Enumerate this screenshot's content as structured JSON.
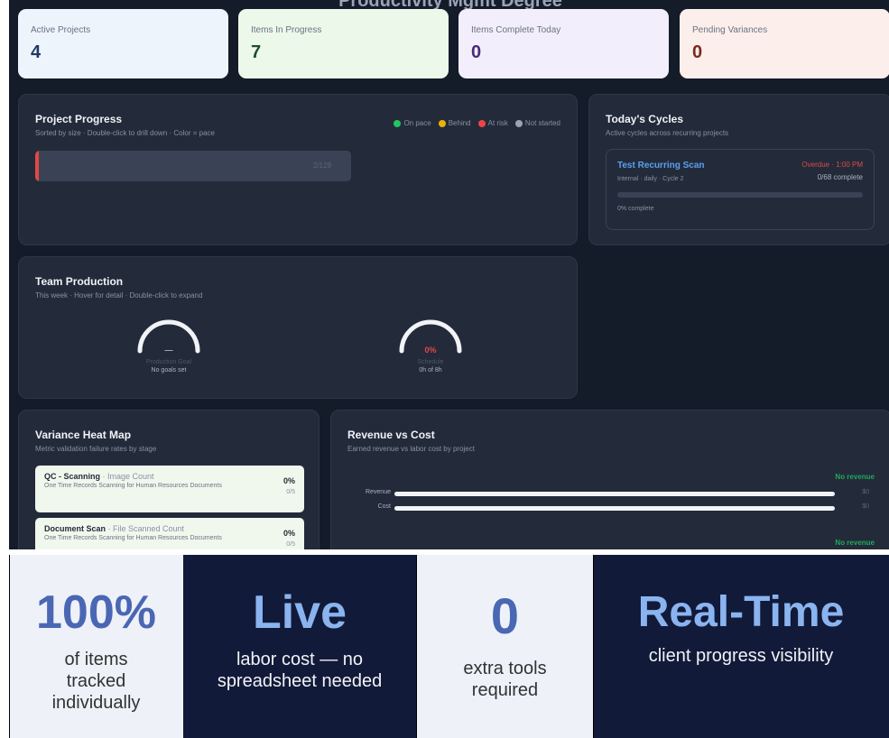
{
  "page_title": "Productivity Mgmt Degree",
  "stats": [
    {
      "label": "Active Projects",
      "value": "4",
      "bg": "#eef4fc",
      "color": "#1f3a68"
    },
    {
      "label": "Items In Progress",
      "value": "7",
      "bg": "#ecf8ea",
      "color": "#1f4f2a"
    },
    {
      "label": "Items Complete Today",
      "value": "0",
      "bg": "#f3eefb",
      "color": "#4a2a7a"
    },
    {
      "label": "Pending Variances",
      "value": "0",
      "bg": "#fcefeb",
      "color": "#7a2a1f"
    }
  ],
  "project_progress": {
    "title": "Project Progress",
    "subtitle": "Sorted by size · Double-click to drill down · Color = pace",
    "legend": [
      {
        "label": "On pace",
        "color": "#22c55e"
      },
      {
        "label": "Behind",
        "color": "#eab308"
      },
      {
        "label": "At risk",
        "color": "#ef4444"
      },
      {
        "label": "Not started",
        "color": "#9ca3af"
      }
    ],
    "bar_text": "2/129",
    "bar_fraction": 0.016
  },
  "todays_cycles": {
    "title": "Today's Cycles",
    "subtitle": "Active cycles across recurring projects",
    "cycle": {
      "name": "Test Recurring Scan",
      "overdue": "Overdue · 1:00 PM",
      "meta": "Internal · daily · Cycle 2",
      "count": "0/68 complete",
      "pct": "0% complete",
      "progress": 0
    }
  },
  "team_production": {
    "title": "Team Production",
    "subtitle": "This week · Hover for detail · Double-click to expand",
    "gauges": [
      {
        "value": "—",
        "label": "Production Goal",
        "sub": "No goals set",
        "value_color": "#aab2c0"
      },
      {
        "value": "0%",
        "label": "Schedule",
        "sub": "0h of 8h",
        "value_color": "#e04848"
      }
    ]
  },
  "variance": {
    "title": "Variance Heat Map",
    "subtitle": "Metric validation failure rates by stage",
    "rows": [
      {
        "stage": "QC - Scanning",
        "metric": " · Image Count",
        "desc": "One Time Records Scanning for Human Resources Documents",
        "pct": "0%",
        "frac": "0/5"
      },
      {
        "stage": "Document Scan",
        "metric": " · File Scanned Count",
        "desc": "One Time Records Scanning for Human Resources Documents",
        "pct": "0%",
        "frac": "0/5"
      }
    ]
  },
  "revenue": {
    "title": "Revenue vs Cost",
    "subtitle": "Earned revenue vs labor cost by project",
    "no_revenue": "No revenue",
    "rows": [
      {
        "label": "Revenue",
        "value": "$0"
      },
      {
        "label": "Cost",
        "value": "$0"
      }
    ]
  },
  "tiles": [
    {
      "big": "100%",
      "caption": "of items tracked individually",
      "theme": "light"
    },
    {
      "big": "Live",
      "caption": "labor cost — no spreadsheet needed",
      "theme": "dark"
    },
    {
      "big": "0",
      "caption": "extra tools required",
      "theme": "light"
    },
    {
      "big": "Real-Time",
      "caption": "client progress visibility",
      "theme": "dark"
    }
  ]
}
